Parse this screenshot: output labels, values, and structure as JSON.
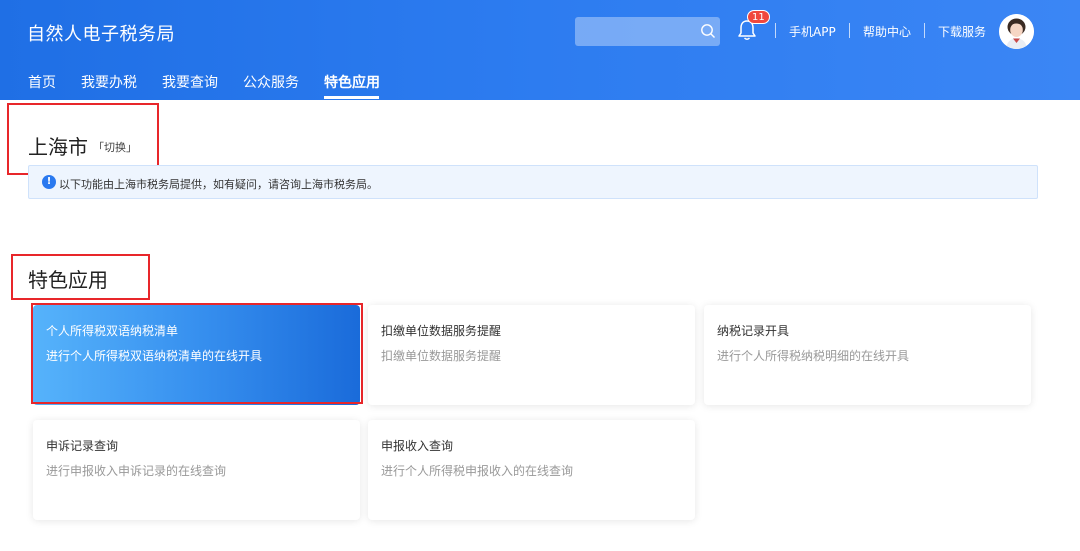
{
  "header": {
    "title": "自然人电子税务局",
    "search_placeholder": "",
    "notification_count": "11",
    "links": [
      "手机APP",
      "帮助中心",
      "下载服务"
    ]
  },
  "nav": {
    "items": [
      "首页",
      "我要办税",
      "我要查询",
      "公众服务",
      "特色应用"
    ],
    "active": "特色应用"
  },
  "city": {
    "name": "上海市",
    "switch_label": "「切换」",
    "notice": "以下功能由上海市税务局提供，如有疑问，请咨询上海市税务局。"
  },
  "features": {
    "title": "特色应用",
    "cards": [
      {
        "title": "个人所得税双语纳税清单",
        "desc": "进行个人所得税双语纳税清单的在线开具"
      },
      {
        "title": "扣缴单位数据服务提醒",
        "desc": "扣缴单位数据服务提醒"
      },
      {
        "title": "纳税记录开具",
        "desc": "进行个人所得税纳税明细的在线开具"
      },
      {
        "title": "申诉记录查询",
        "desc": "进行申报收入申诉记录的在线查询"
      },
      {
        "title": "申报收入查询",
        "desc": "进行个人所得税申报收入的在线查询"
      }
    ]
  },
  "colors": {
    "header": "#2d7cf0",
    "highlight_border": "#e8262a",
    "badge": "#f0483e"
  },
  "icons": [
    "search-icon",
    "bell-icon",
    "info-icon",
    "avatar"
  ]
}
